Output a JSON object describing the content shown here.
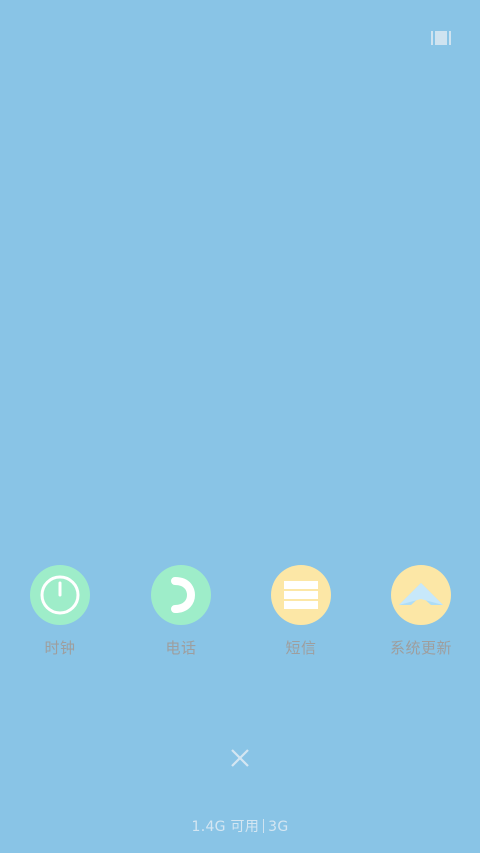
{
  "apps": [
    {
      "label": "时钟",
      "icon": "clock-icon",
      "color": "#9EEDC9"
    },
    {
      "label": "电话",
      "icon": "phone-icon",
      "color": "#9EEDC9"
    },
    {
      "label": "短信",
      "icon": "message-icon",
      "color": "#FCE7A6"
    },
    {
      "label": "系统更新",
      "icon": "system-update-icon",
      "color": "#FCE7A6"
    }
  ],
  "memory": {
    "available": "1.4G 可用",
    "network": "3G"
  },
  "colors": {
    "background": "#89C4E6",
    "label": "#9E9E9E"
  }
}
